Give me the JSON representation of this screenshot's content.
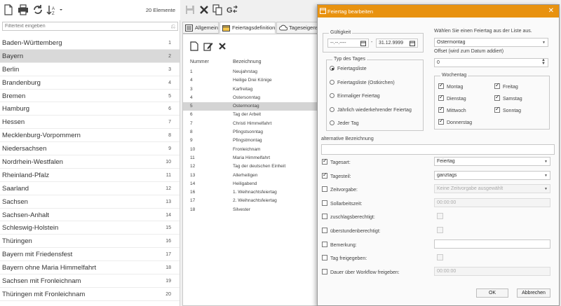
{
  "list": {
    "count_label": "20 Elemente",
    "filter_placeholder": "Filtertext eingeben",
    "items": [
      {
        "name": "Baden-Württemberg",
        "no": "1"
      },
      {
        "name": "Bayern",
        "no": "2"
      },
      {
        "name": "Berlin",
        "no": "3"
      },
      {
        "name": "Brandenburg",
        "no": "4"
      },
      {
        "name": "Bremen",
        "no": "5"
      },
      {
        "name": "Hamburg",
        "no": "6"
      },
      {
        "name": "Hessen",
        "no": "7"
      },
      {
        "name": "Mecklenburg-Vorpommern",
        "no": "8"
      },
      {
        "name": "Niedersachsen",
        "no": "9"
      },
      {
        "name": "Nordrhein-Westfalen",
        "no": "10"
      },
      {
        "name": "Rheinland-Pfalz",
        "no": "11"
      },
      {
        "name": "Saarland",
        "no": "12"
      },
      {
        "name": "Sachsen",
        "no": "13"
      },
      {
        "name": "Sachsen-Anhalt",
        "no": "14"
      },
      {
        "name": "Schleswig-Holstein",
        "no": "15"
      },
      {
        "name": "Thüringen",
        "no": "16"
      },
      {
        "name": "Bayern mit Friedensfest",
        "no": "17"
      },
      {
        "name": "Bayern ohne Maria Himmelfahrt",
        "no": "18"
      },
      {
        "name": "Sachsen mit Fronleichnam",
        "no": "19"
      },
      {
        "name": "Thüringen mit Fronleichnam",
        "no": "20"
      }
    ],
    "selected_index": 1
  },
  "tabs": [
    {
      "label": "Allgemein"
    },
    {
      "label": "Feiertagsdefinition"
    },
    {
      "label": "Tageseigensch"
    }
  ],
  "holidays": {
    "col_number": "Nummer",
    "col_name": "Bezeichnung",
    "rows": [
      {
        "no": "1",
        "name": "Neujahrstag"
      },
      {
        "no": "4",
        "name": "Heilige Drei Könige"
      },
      {
        "no": "3",
        "name": "Karfreitag"
      },
      {
        "no": "4",
        "name": "Ostersonntag"
      },
      {
        "no": "5",
        "name": "Ostermontag"
      },
      {
        "no": "6",
        "name": "Tag der Arbeit"
      },
      {
        "no": "7",
        "name": "Christi Himmelfahrt"
      },
      {
        "no": "8",
        "name": "Pfingstsonntag"
      },
      {
        "no": "9",
        "name": "Pfingstmontag"
      },
      {
        "no": "10",
        "name": "Fronleichnam"
      },
      {
        "no": "11",
        "name": "Maria Himmelfahrt"
      },
      {
        "no": "12",
        "name": "Tag der deutschen Einheit"
      },
      {
        "no": "13",
        "name": "Allerheiligen"
      },
      {
        "no": "14",
        "name": "Heiligabend"
      },
      {
        "no": "16",
        "name": "1. Weihnachtsfeiertag"
      },
      {
        "no": "17",
        "name": "2. Weihnachtsfeiertag"
      },
      {
        "no": "18",
        "name": "Silvester"
      }
    ],
    "selected_index": 4
  },
  "dialog": {
    "title": "Feiertag bearbeiten",
    "validity_legend": "Gültigkeit",
    "date_from": "--.--.----",
    "date_sep": "-",
    "date_to": "31.12.9999",
    "choose_label": "Wählen Sie einen Feiertag aus der Liste aus.",
    "choose_value": "Ostermontag",
    "offset_label": "Offset (wird zum Datum addiert)",
    "offset_value": "0",
    "daytype_legend": "Typ des Tages",
    "daytypes": [
      {
        "label": "Feiertagsliste",
        "checked": true
      },
      {
        "label": "Feiertagsliste (Ostkirchen)",
        "checked": false
      },
      {
        "label": "Einmaliger Feiertag",
        "checked": false
      },
      {
        "label": "Jährlich wiederkehrender Feiertag",
        "checked": false
      },
      {
        "label": "Jeder Tag",
        "checked": false
      }
    ],
    "weekday_legend": "Wochentag",
    "weekdays": [
      {
        "label": "Montag",
        "checked": true
      },
      {
        "label": "Freitag",
        "checked": true
      },
      {
        "label": "Dienstag",
        "checked": true
      },
      {
        "label": "Samstag",
        "checked": true
      },
      {
        "label": "Mittwoch",
        "checked": true
      },
      {
        "label": "Sonntag",
        "checked": true
      },
      {
        "label": "Donnerstag",
        "checked": true
      }
    ],
    "alt_label": "alternative Bezeichnung",
    "alt_value": "",
    "props": [
      {
        "label": "Tagesart:",
        "checked": true,
        "value": "Feiertag",
        "kind": "select"
      },
      {
        "label": "Tagesteil:",
        "checked": true,
        "value": "ganztags",
        "kind": "select"
      },
      {
        "label": "Zeitvorgabe:",
        "checked": false,
        "value": "Keine Zeitvorgabe ausgewählt",
        "kind": "select-dis"
      },
      {
        "label": "Sollarbeitszeit:",
        "checked": false,
        "value": "00:00:00",
        "kind": "input-dis"
      },
      {
        "label": "zuschlagsberechtigt:",
        "checked": false,
        "value": "",
        "kind": "check-dis"
      },
      {
        "label": "überstundenberechtigt:",
        "checked": false,
        "value": "",
        "kind": "check-dis"
      },
      {
        "label": "Bemerkung:",
        "checked": false,
        "value": "",
        "kind": "input"
      },
      {
        "label": "Tag freigegeben:",
        "checked": false,
        "value": "",
        "kind": "check-dis"
      },
      {
        "label": "Dauer über Workflow freigeben:",
        "checked": false,
        "value": "00:00:00",
        "kind": "input-dis"
      }
    ],
    "ok_label": "OK",
    "cancel_label": "Abbrechen"
  },
  "colors": {
    "accent": "#e8920f",
    "selection": "#d9d9d9"
  }
}
